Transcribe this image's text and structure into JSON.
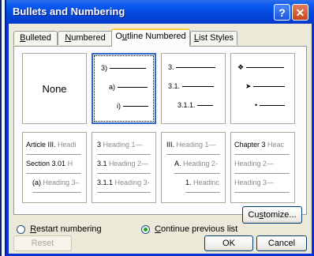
{
  "window": {
    "title": "Bullets and Numbering"
  },
  "tabs": [
    {
      "label": "Bulleted",
      "accel": "B",
      "rest": "ulleted"
    },
    {
      "label": "Numbered",
      "accel": "N",
      "rest": "umbered"
    },
    {
      "label": "Outline Numbered",
      "pre": "O",
      "accel": "u",
      "rest": "tline Numbered"
    },
    {
      "label": "List Styles",
      "accel": "L",
      "rest": "ist Styles"
    }
  ],
  "gallery": {
    "none_label": "None",
    "cell2": [
      "3)",
      "a)",
      "i)"
    ],
    "cell3": [
      "3.",
      "3.1.",
      "3.1.1."
    ],
    "cell4": [
      "❖",
      "➤",
      "•"
    ],
    "cell5": {
      "r1a": "Article III.",
      "r1b": "Headi",
      "r2a": "Section 3.01",
      "r2b": "H",
      "r3a": "(a)",
      "r3b": "Heading 3–"
    },
    "cell6": {
      "r1a": "3",
      "r1b": "Heading 1—",
      "r2a": "3.1",
      "r2b": "Heading 2—",
      "r3a": "3.1.1",
      "r3b": "Heading 3-"
    },
    "cell7": {
      "r1a": "III.",
      "r1b": "Heading 1—",
      "r2a": "A.",
      "r2b": "Heading 2-",
      "r3a": "1.",
      "r3b": "Headinc"
    },
    "cell8": {
      "r1a": "Chapter 3",
      "r1b": "Heac",
      "r2": "Heading 2—",
      "r3": "Heading 3—"
    }
  },
  "options": {
    "restart": {
      "accel": "R",
      "rest": "estart numbering"
    },
    "continue": {
      "accel": "C",
      "rest": "ontinue previous list"
    },
    "customize": {
      "pre": "Cu",
      "accel": "s",
      "rest": "tomize..."
    }
  },
  "buttons": {
    "reset": "Reset",
    "ok": "OK",
    "cancel": "Cancel"
  },
  "colors": {
    "title_bar": "#0548DE",
    "tab_highlight": "#FFC83C",
    "selected_border": "#316AC5"
  }
}
